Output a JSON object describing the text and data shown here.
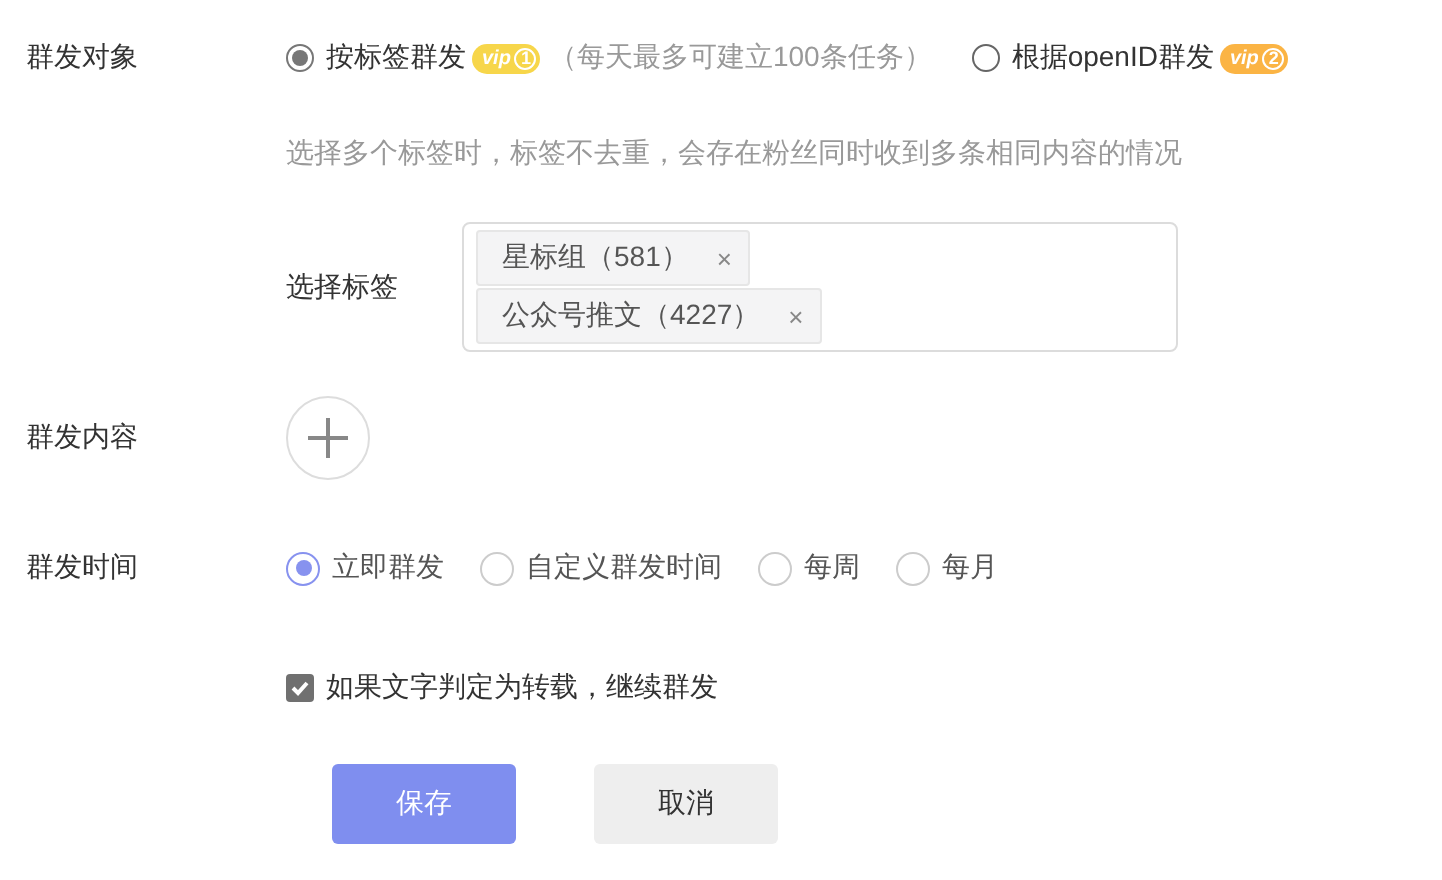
{
  "target": {
    "label": "群发对象",
    "options": [
      {
        "label": "按标签群发",
        "selected": true,
        "badge": {
          "text": "vip",
          "tier": "1",
          "color": "#f7d64a"
        },
        "note": "（每天最多可建立100条任务）"
      },
      {
        "label": "根据openID群发",
        "selected": false,
        "badge": {
          "text": "vip",
          "tier": "2",
          "color": "#fbb444"
        }
      }
    ],
    "hint": "选择多个标签时，标签不去重，会存在粉丝同时收到多条相同内容的情况"
  },
  "tags": {
    "label": "选择标签",
    "items": [
      {
        "text": "星标组（581）",
        "close": "×"
      },
      {
        "text": "公众号推文（4227）",
        "close": "×"
      }
    ]
  },
  "content": {
    "label": "群发内容"
  },
  "time": {
    "label": "群发时间",
    "options": [
      {
        "label": "立即群发",
        "selected": true
      },
      {
        "label": "自定义群发时间",
        "selected": false
      },
      {
        "label": "每周",
        "selected": false
      },
      {
        "label": "每月",
        "selected": false
      }
    ]
  },
  "repost": {
    "label": "如果文字判定为转载，继续群发",
    "checked": true
  },
  "buttons": [
    {
      "label": "保存",
      "kind": "primary"
    },
    {
      "label": "取消",
      "kind": "secondary"
    }
  ]
}
